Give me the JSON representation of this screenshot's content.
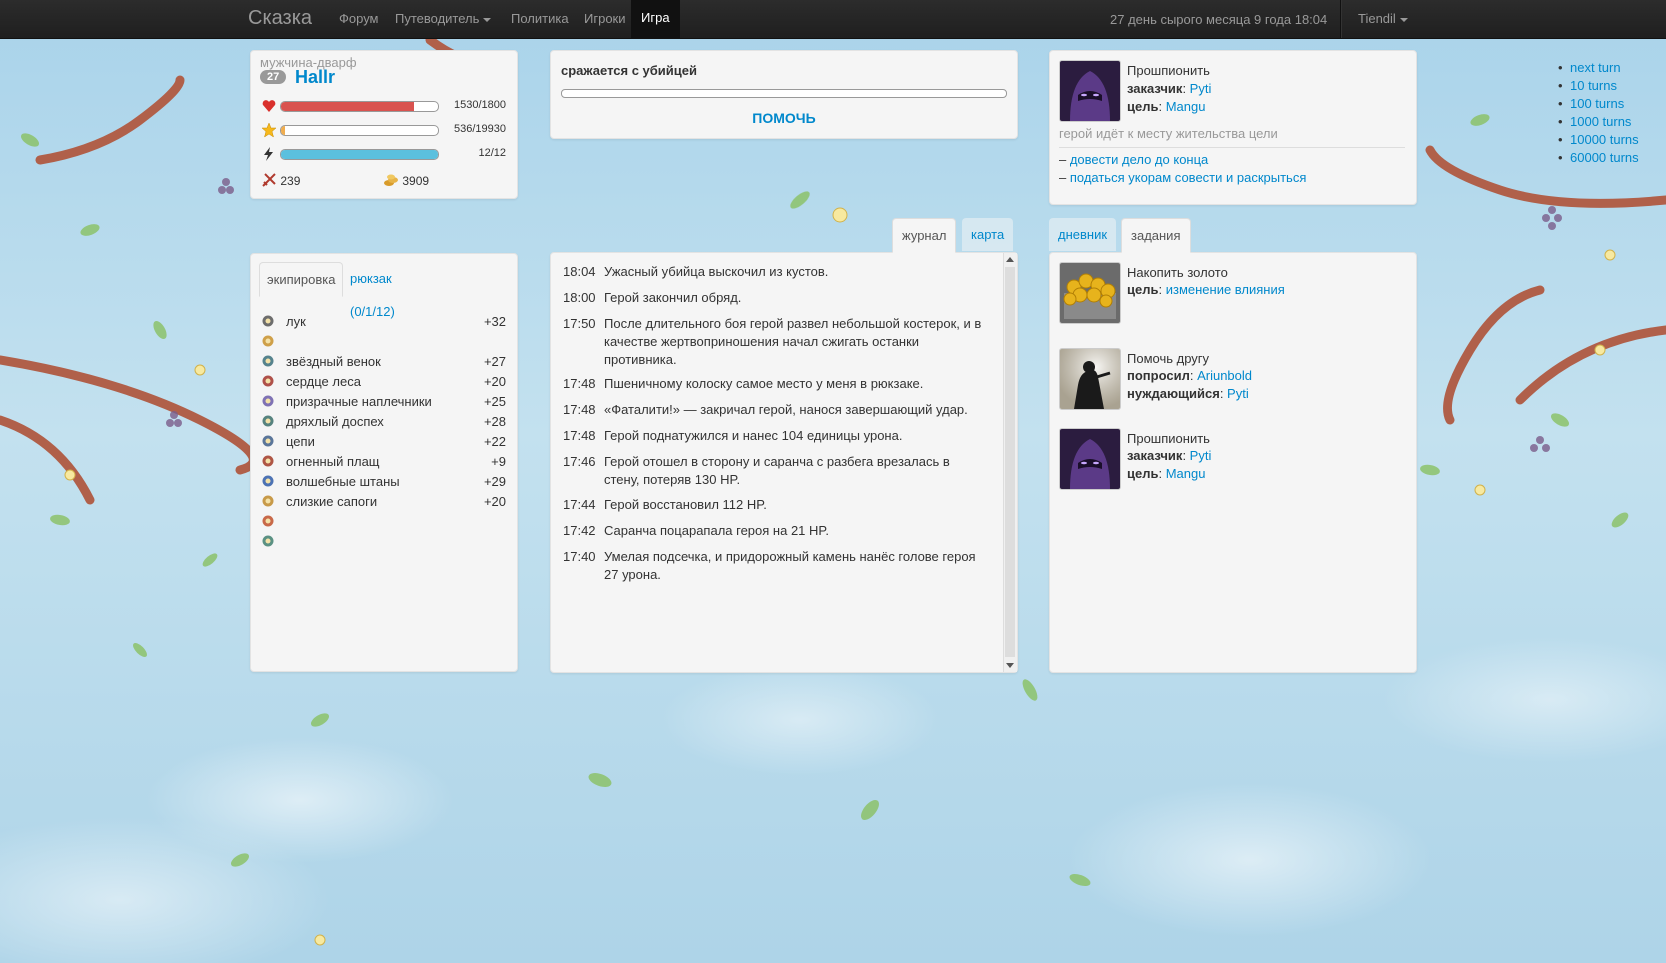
{
  "navbar": {
    "brand": "Сказка",
    "items": [
      "Форум",
      "Путеводитель",
      "Политика",
      "Игроки",
      "Игра"
    ],
    "active": "Игра",
    "game_date": "27 день сырого месяца 9 года 18:04",
    "user": "Tiendil"
  },
  "hero": {
    "race": "мужчина-дварф",
    "level": "27",
    "name": "Hallr",
    "health": {
      "text": "1530/1800",
      "fraction": 0.85
    },
    "experience": {
      "text": "536/19930",
      "fraction": 0.027
    },
    "energy": {
      "text": "12/12",
      "fraction": 1.0
    },
    "might": "239",
    "money": "3909"
  },
  "equipment": {
    "tabs": [
      "экипировка",
      "рюкзак (0/1/12)"
    ],
    "items": [
      {
        "name": "лук",
        "power": "+32",
        "icon": "bow-icon"
      },
      {
        "name": "",
        "power": "",
        "icon": "amulet-icon"
      },
      {
        "name": "звёздный венок",
        "power": "+27",
        "icon": "helmet-icon"
      },
      {
        "name": "сердце леса",
        "power": "+20",
        "icon": "weapon-icon"
      },
      {
        "name": "призрачные наплечники",
        "power": "+25",
        "icon": "shoulders-icon"
      },
      {
        "name": "дряхлый доспех",
        "power": "+28",
        "icon": "armor-icon"
      },
      {
        "name": "цепи",
        "power": "+22",
        "icon": "gloves-icon"
      },
      {
        "name": "огненный плащ",
        "power": "+9",
        "icon": "cloak-icon"
      },
      {
        "name": "волшебные штаны",
        "power": "+29",
        "icon": "pants-icon"
      },
      {
        "name": "слизкие сапоги",
        "power": "+20",
        "icon": "boots-icon"
      },
      {
        "name": "",
        "power": "",
        "icon": "ring-icon"
      },
      {
        "name": "",
        "power": "",
        "icon": "ring2-icon"
      }
    ]
  },
  "action": {
    "text": "сражается с убийцей",
    "progress": 0,
    "help_label": "ПОМОЧЬ"
  },
  "journal": {
    "tabs": [
      "журнал",
      "карта"
    ],
    "entries": [
      {
        "time": "18:04",
        "msg": "Ужасный убийца выскочил из кустов."
      },
      {
        "time": "18:00",
        "msg": "Герой закончил обряд."
      },
      {
        "time": "17:50",
        "msg": "После длительного боя герой развел небольшой костерок, и в качестве жертвоприношения начал сжигать останки противника."
      },
      {
        "time": "17:48",
        "msg": "Пшеничному колоску самое место у меня в рюкзаке."
      },
      {
        "time": "17:48",
        "msg": "«Фаталити!» — закричал герой, нанося завершающий удар."
      },
      {
        "time": "17:48",
        "msg": "Герой поднатужился и нанес 104 единицы урона."
      },
      {
        "time": "17:46",
        "msg": "Герой отошел в сторону и саранча с разбега врезалась в стену, потеряв 130 HP."
      },
      {
        "time": "17:44",
        "msg": "Герой восстановил 112 HP."
      },
      {
        "time": "17:42",
        "msg": "Саранча поцарапала героя на 21 HP."
      },
      {
        "time": "17:40",
        "msg": "Умелая подсечка, и придорожный камень нанёс голове героя 27 урона."
      }
    ]
  },
  "current_quest": {
    "title": "Прошпионить",
    "customer_label": "заказчик",
    "customer": "Pyti",
    "target_label": "цель",
    "target": "Mangu",
    "status": "герой идёт к месту жительства цели",
    "choices": [
      "довести дело до конца",
      "податься укорам совести и раскрыться"
    ]
  },
  "quests": {
    "tabs": [
      "дневник",
      "задания"
    ],
    "items": [
      {
        "title": "Накопить золото",
        "lines": [
          {
            "label": "цель",
            "value": "изменение влияния"
          }
        ]
      },
      {
        "title": "Помочь другу",
        "lines": [
          {
            "label": "попросил",
            "value": "Ariunbold"
          },
          {
            "label": "нуждающийся",
            "value": "Pyti"
          }
        ]
      },
      {
        "title": "Прошпионить",
        "lines": [
          {
            "label": "заказчик",
            "value": "Pyti"
          },
          {
            "label": "цель",
            "value": "Mangu"
          }
        ]
      }
    ]
  },
  "turns": [
    "next turn",
    "10 turns",
    "100 turns",
    "1000 turns",
    "10000 turns",
    "60000 turns"
  ],
  "colors": {
    "health": "#d9534f",
    "experience": "#f0ad4e",
    "energy": "#5bc0de",
    "link": "#0088cc",
    "navbar": "#222222"
  }
}
